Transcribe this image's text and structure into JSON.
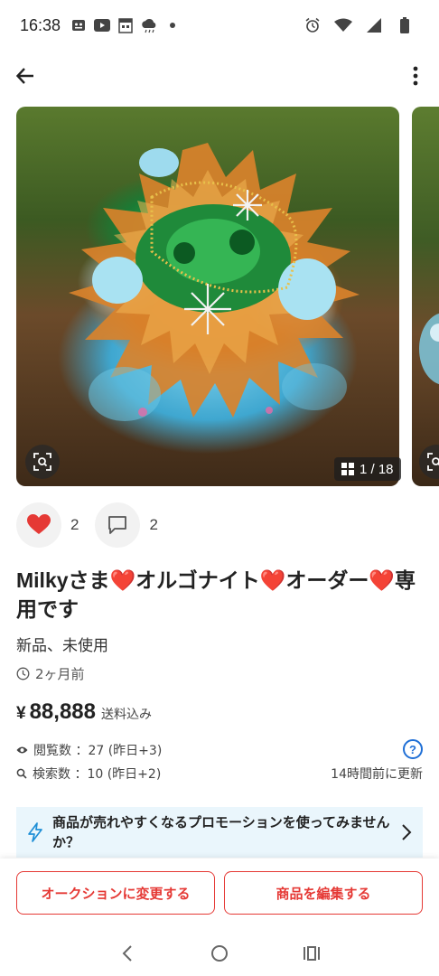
{
  "status_bar": {
    "time": "16:38",
    "left_icons": [
      "app-notification-icon",
      "youtube-icon",
      "calendar-icon",
      "weather-icon",
      "dot-icon"
    ],
    "right_icons": [
      "alarm-icon",
      "wifi-icon",
      "signal-icon",
      "battery-icon"
    ]
  },
  "app_bar": {
    "back_icon": "arrow-left-icon",
    "more_icon": "more-vertical-icon"
  },
  "gallery": {
    "counter": "1 / 18",
    "lens_icon": "image-search-icon"
  },
  "reactions": {
    "likes": "2",
    "comments": "2",
    "like_color": "#e53935"
  },
  "item": {
    "title": "Milkyさま❤️オルゴナイト❤️オーダー❤️専用です",
    "condition": "新品、未使用",
    "posted": "2ヶ月前",
    "price_currency": "¥",
    "price": "88,888",
    "shipping": "送料込み"
  },
  "stats": {
    "views": "閲覧数 ：27 (昨日+3)",
    "searches": "検索数 ：10 (昨日+2)",
    "updated": "14時間前に更新",
    "help_label": "?"
  },
  "promo": {
    "text": "商品が売れやすくなるプロモーションを使ってみませんか？",
    "bg_color": "#eaf6fc"
  },
  "actions": {
    "auction_label": "オークションに変更する",
    "edit_label": "商品を編集する",
    "accent": "#e53935"
  }
}
